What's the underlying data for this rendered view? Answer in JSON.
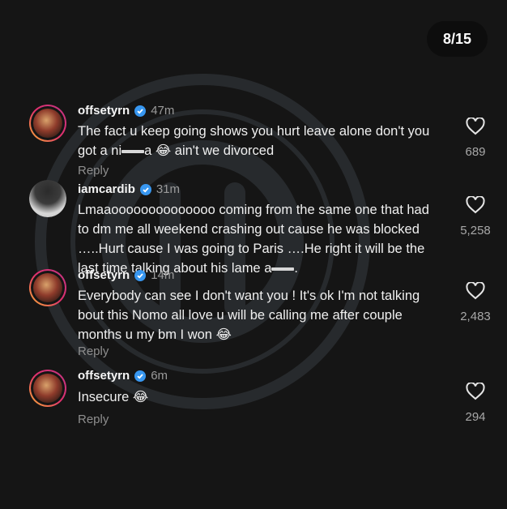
{
  "page_counter": "8/15",
  "colors": {
    "background": "#151515",
    "verified_blue": "#3897f0",
    "secondary_text": "#9a9a9a"
  },
  "comments": [
    {
      "username": "offsetyrn",
      "time": "47m",
      "text_before": "The fact u keep going shows you hurt leave alone don't you got a ni",
      "censored_mid": "a",
      "emoji": "😂",
      "text_after": " ain't we divorced",
      "reply": "Reply",
      "likes": "689"
    },
    {
      "username": "iamcardib",
      "time": "31m",
      "text_before": "Lmaaoooooooooooooo coming from the same one that had to dm me all weekend crashing out cause he was blocked …..Hurt cause I was going to Paris ….He right it will be the last time talking about his lame a",
      "text_after": ".",
      "likes": "5,258"
    },
    {
      "username": "offsetyrn",
      "time": "14m",
      "text": "Everybody can see I don't want you ! It's ok I'm not talking bout this Nomo all love u will be calling me after couple months u my bm I won",
      "emoji": "😂",
      "reply": "Reply",
      "likes": "2,483"
    },
    {
      "username": "offsetyrn",
      "time": "6m",
      "text": "Insecure",
      "emoji": "😂",
      "reply": "Reply",
      "likes": "294"
    }
  ],
  "icons": {
    "verified": "verified-badge-icon",
    "heart": "heart-outline-icon"
  }
}
